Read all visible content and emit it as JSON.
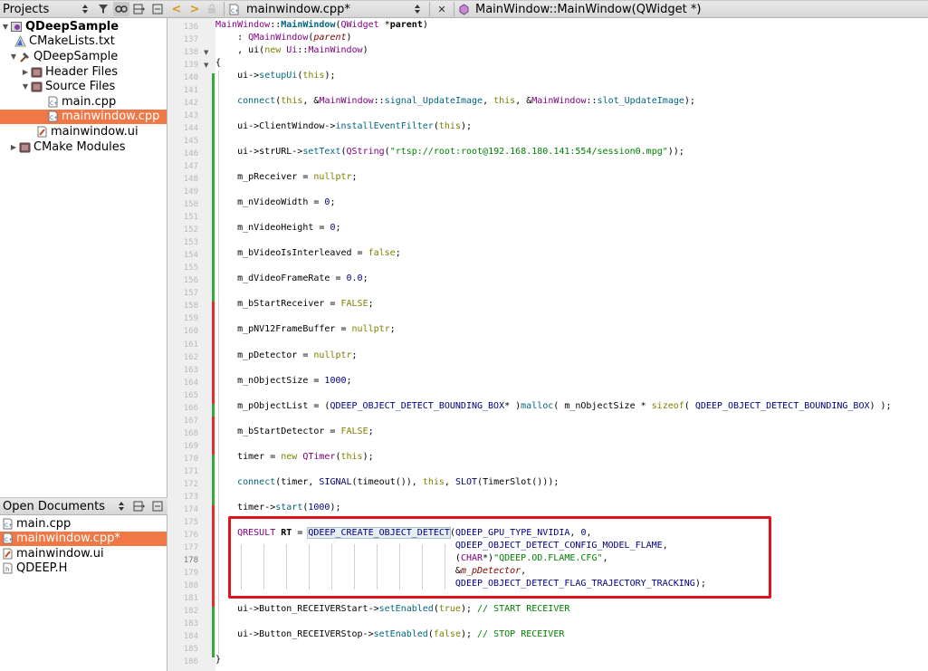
{
  "projects_pane": {
    "title": "Projects",
    "tree": [
      {
        "label": "QDeepSample"
      },
      {
        "label": "CMakeLists.txt"
      },
      {
        "label": "QDeepSample"
      },
      {
        "label": "Header Files"
      },
      {
        "label": "Source Files"
      },
      {
        "label": "main.cpp"
      },
      {
        "label": "mainwindow.cpp"
      },
      {
        "label": "mainwindow.ui"
      },
      {
        "label": "CMake Modules"
      }
    ]
  },
  "open_documents": {
    "title": "Open Documents",
    "items": [
      {
        "label": "main.cpp"
      },
      {
        "label": "mainwindow.cpp*"
      },
      {
        "label": "mainwindow.ui"
      },
      {
        "label": "QDEEP.H"
      }
    ]
  },
  "editor_toolbar": {
    "file_name": "mainwindow.cpp*",
    "close_glyph": "✕",
    "symbol": "MainWindow::MainWindow(QWidget *)"
  },
  "colors": {
    "selection": "#f07746",
    "highlight_box": "#e0141e",
    "change_green": "#3aa83a",
    "change_red": "#e03030"
  },
  "line_numbers": [
    "136",
    "137",
    "138",
    "139",
    "140",
    "141",
    "142",
    "143",
    "144",
    "145",
    "146",
    "147",
    "148",
    "149",
    "150",
    "151",
    "152",
    "153",
    "154",
    "155",
    "156",
    "157",
    "158",
    "159",
    "160",
    "161",
    "162",
    "163",
    "164",
    "165",
    "166",
    "167",
    "168",
    "169",
    "170",
    "171",
    "172",
    "173",
    "174",
    "175",
    "176",
    "177",
    "178",
    "179",
    "180",
    "181",
    "182",
    "183",
    "184",
    "185",
    "186"
  ],
  "current_line": "178",
  "code": [
    {
      "text": "MainWindow::MainWindow(QWidget *parent)"
    },
    {
      "text": "    : QMainWindow(parent)"
    },
    {
      "text": "    , ui(new Ui::MainWindow)"
    },
    {
      "text": "{"
    },
    {
      "text": "    ui->setupUi(this);"
    },
    {
      "text": ""
    },
    {
      "text": "    connect(this, &MainWindow::signal_UpdateImage, this, &MainWindow::slot_UpdateImage);"
    },
    {
      "text": ""
    },
    {
      "text": "    ui->ClientWindow->installEventFilter(this);"
    },
    {
      "text": ""
    },
    {
      "text": "    ui->strURL->setText(QString(\"rtsp://root:root@192.168.180.141:554/session0.mpg\"));"
    },
    {
      "text": ""
    },
    {
      "text": "    m_pReceiver = nullptr;"
    },
    {
      "text": ""
    },
    {
      "text": "    m_nVideoWidth = 0;"
    },
    {
      "text": ""
    },
    {
      "text": "    m_nVideoHeight = 0;"
    },
    {
      "text": ""
    },
    {
      "text": "    m_bVideoIsInterleaved = false;"
    },
    {
      "text": ""
    },
    {
      "text": "    m_dVideoFrameRate = 0.0;"
    },
    {
      "text": ""
    },
    {
      "text": "    m_bStartReceiver = FALSE;"
    },
    {
      "text": ""
    },
    {
      "text": "    m_pNV12FrameBuffer = nullptr;"
    },
    {
      "text": ""
    },
    {
      "text": "    m_pDetector = nullptr;"
    },
    {
      "text": ""
    },
    {
      "text": "    m_nObjectSize = 1000;"
    },
    {
      "text": ""
    },
    {
      "text": "    m_pObjectList = (QDEEP_OBJECT_DETECT_BOUNDING_BOX* )malloc( m_nObjectSize * sizeof( QDEEP_OBJECT_DETECT_BOUNDING_BOX) );"
    },
    {
      "text": ""
    },
    {
      "text": "    m_bStartDetector = FALSE;"
    },
    {
      "text": ""
    },
    {
      "text": "    timer = new QTimer(this);"
    },
    {
      "text": ""
    },
    {
      "text": "    connect(timer, SIGNAL(timeout()), this, SLOT(TimerSlot()));"
    },
    {
      "text": ""
    },
    {
      "text": "    timer->start(1000);"
    },
    {
      "text": ""
    },
    {
      "text": "    QRESULT RT = QDEEP_CREATE_OBJECT_DETECT(QDEEP_GPU_TYPE_NVIDIA, 0,"
    },
    {
      "text": "                                            QDEEP_OBJECT_DETECT_CONFIG_MODEL_FLAME,"
    },
    {
      "text": "                                            (CHAR*)\"QDEEP.OD.FLAME.CFG\","
    },
    {
      "text": "                                            &m_pDetector,"
    },
    {
      "text": "                                            QDEEP_OBJECT_DETECT_FLAG_TRAJECTORY_TRACKING);"
    },
    {
      "text": ""
    },
    {
      "text": "    ui->Button_RECEIVERStart->setEnabled(true); // START RECEIVER"
    },
    {
      "text": ""
    },
    {
      "text": "    ui->Button_RECEIVERStop->setEnabled(false); // STOP RECEIVER"
    },
    {
      "text": ""
    },
    {
      "text": "}"
    }
  ]
}
